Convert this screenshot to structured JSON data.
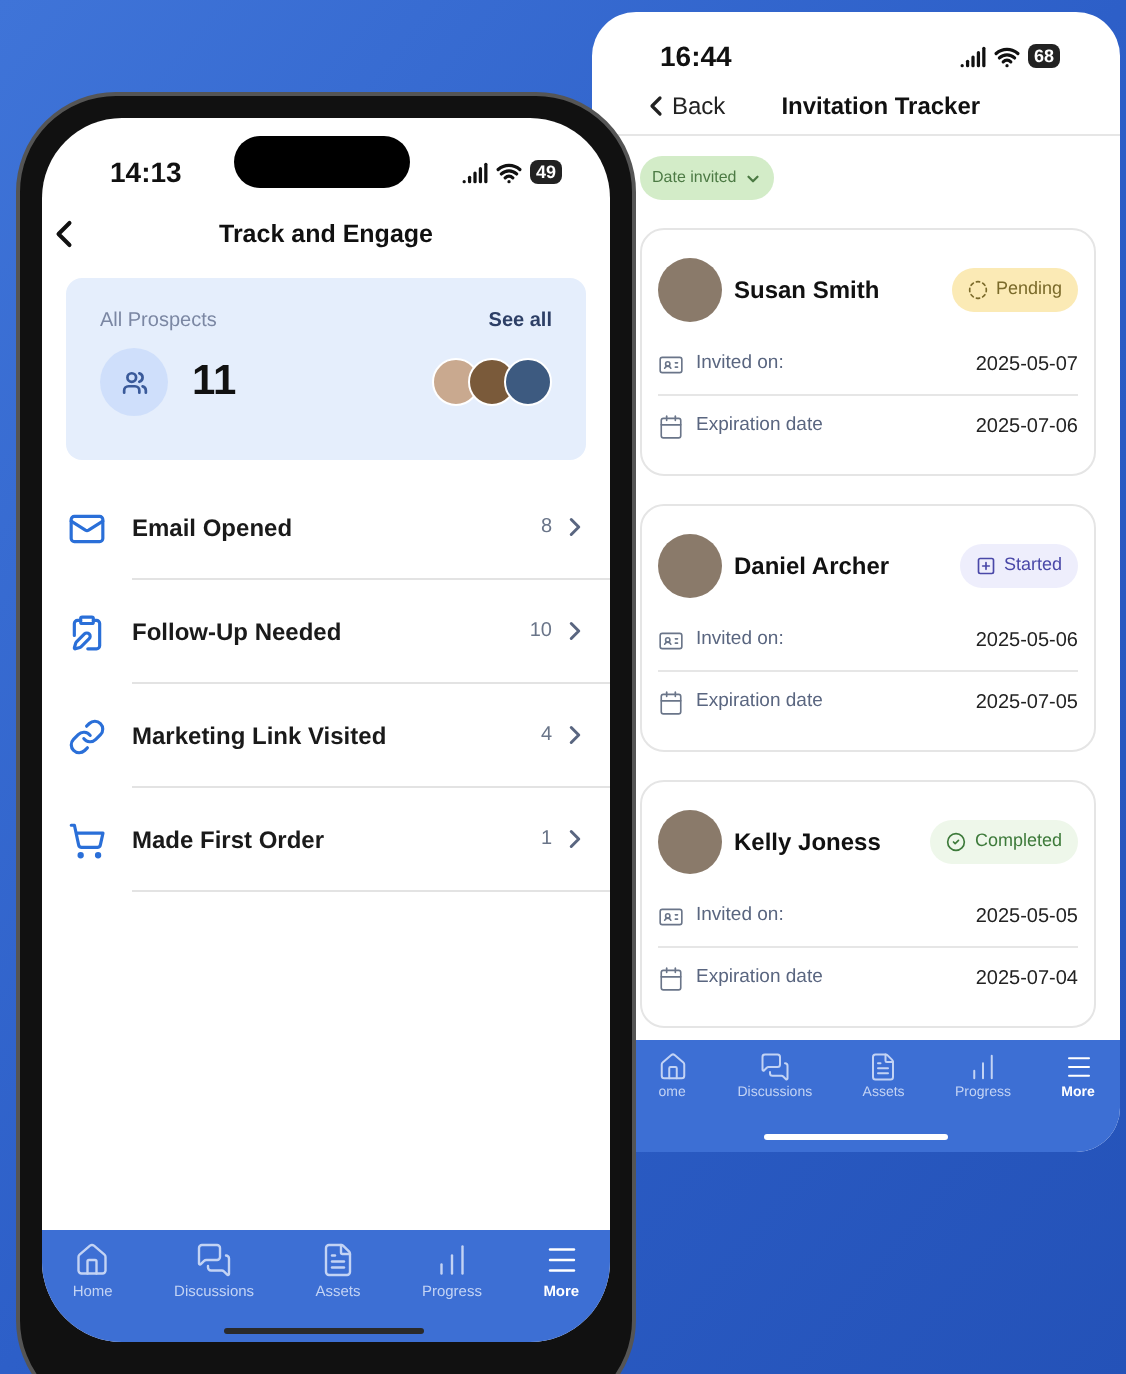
{
  "left_phone": {
    "status_bar": {
      "time": "14:13",
      "battery": "49"
    },
    "header": {
      "title": "Track and Engage"
    },
    "prospects_card": {
      "label": "All Prospects",
      "link": "See all",
      "count": "11"
    },
    "items": [
      {
        "kind": "email",
        "label": "Email Opened",
        "count": "8"
      },
      {
        "kind": "followup",
        "label": "Follow-Up Needed",
        "count": "10"
      },
      {
        "kind": "link",
        "label": "Marketing Link Visited",
        "count": "4"
      },
      {
        "kind": "order",
        "label": "Made First Order",
        "count": "1"
      }
    ],
    "tab_bar": [
      {
        "kind": "home",
        "label": "Home",
        "selected": false
      },
      {
        "kind": "discussions",
        "label": "Discussions",
        "selected": false
      },
      {
        "kind": "assets",
        "label": "Assets",
        "selected": false
      },
      {
        "kind": "progress",
        "label": "Progress",
        "selected": false
      },
      {
        "kind": "more",
        "label": "More",
        "selected": true
      }
    ]
  },
  "right_phone": {
    "status_bar": {
      "time": "16:44",
      "battery": "68"
    },
    "header": {
      "back": "Back",
      "title": "Invitation Tracker"
    },
    "filter": {
      "label": "Date invited"
    },
    "invitations": [
      {
        "name": "Susan Smith",
        "status": {
          "kind": "pending",
          "label": "Pending"
        },
        "fields": [
          {
            "kind": "invited",
            "label": "Invited on:",
            "value": "2025-05-07"
          },
          {
            "kind": "expiration",
            "label": "Expiration date",
            "value": "2025-07-06"
          }
        ]
      },
      {
        "name": "Daniel Archer",
        "status": {
          "kind": "started",
          "label": "Started"
        },
        "fields": [
          {
            "kind": "invited",
            "label": "Invited on:",
            "value": "2025-05-06"
          },
          {
            "kind": "expiration",
            "label": "Expiration date",
            "value": "2025-07-05"
          }
        ]
      },
      {
        "name": "Kelly Joness",
        "status": {
          "kind": "completed",
          "label": "Completed"
        },
        "fields": [
          {
            "kind": "invited",
            "label": "Invited on:",
            "value": "2025-05-05"
          },
          {
            "kind": "expiration",
            "label": "Expiration date",
            "value": "2025-07-04"
          }
        ]
      }
    ],
    "tab_bar": [
      {
        "kind": "home",
        "label": "ome",
        "selected": false
      },
      {
        "kind": "discussions",
        "label": "Discussions",
        "selected": false
      },
      {
        "kind": "assets",
        "label": "Assets",
        "selected": false
      },
      {
        "kind": "progress",
        "label": "Progress",
        "selected": false
      },
      {
        "kind": "more",
        "label": "More",
        "selected": true
      }
    ]
  }
}
